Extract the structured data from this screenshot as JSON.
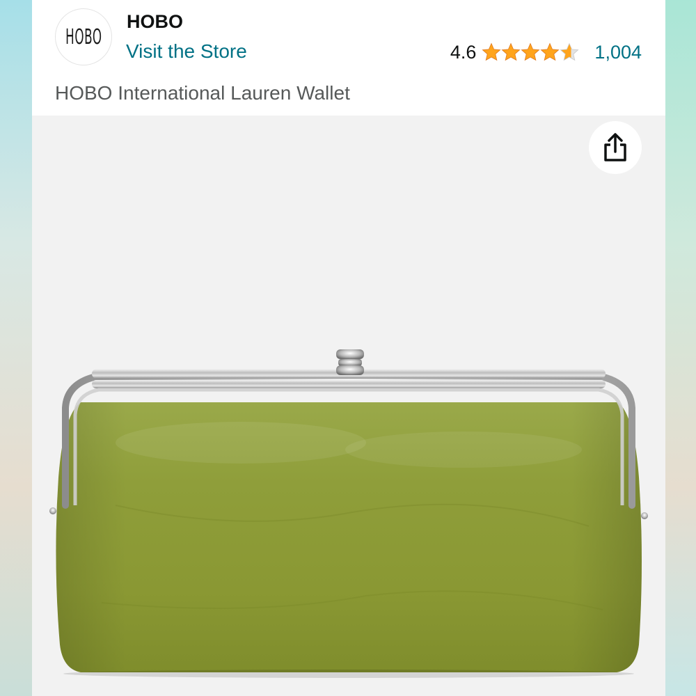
{
  "brand": {
    "logo_text": "HOBO",
    "name": "HOBO",
    "visit_store_label": "Visit the Store"
  },
  "rating": {
    "value": "4.6",
    "stars": 4.6,
    "review_count": "1,004"
  },
  "product": {
    "title": "HOBO International Lauren Wallet",
    "image_description_color": "#8c9b35"
  },
  "icons": {
    "share": "share-icon",
    "star": "star-icon"
  },
  "colors": {
    "link": "#007185",
    "star": "#ffa41c",
    "text": "#0f1111",
    "muted": "#565959"
  }
}
